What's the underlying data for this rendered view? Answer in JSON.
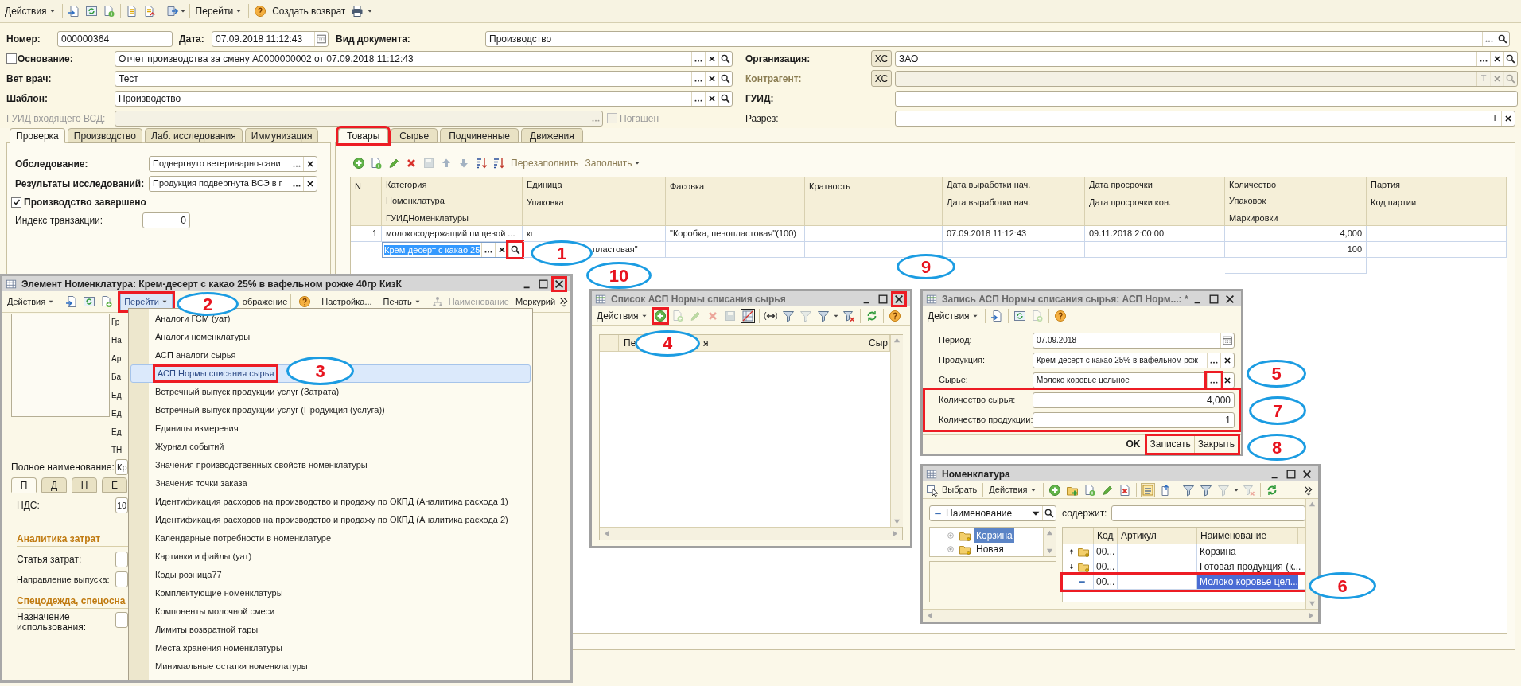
{
  "toolbar": {
    "actions": "Действия",
    "goto": "Перейти",
    "create_return": "Создать возврат"
  },
  "header": {
    "number": {
      "label": "Номер:",
      "value": "000000364"
    },
    "date": {
      "label": "Дата:",
      "value": "07.09.2018 11:12:43"
    },
    "doc_type": {
      "label": "Вид документа:",
      "value": "Производство"
    },
    "basis": {
      "label": "Основание:",
      "checked": false,
      "value": "Отчет производства за смену А0000000002 от 07.09.2018 11:12:43"
    },
    "vet": {
      "label": "Вет врач:",
      "value": "Тест"
    },
    "template": {
      "label": "Шаблон:",
      "value": "Производство"
    },
    "guid_vsd": {
      "label": "ГУИД входящего ВСД:",
      "disabled": true
    },
    "repaid": {
      "label": "Погашен",
      "checked": false,
      "disabled": true
    },
    "organization": {
      "label": "Организация:",
      "button": "ХС",
      "value": "ЗАО"
    },
    "counterparty": {
      "label": "Контрагент:",
      "button": "ХС",
      "disabled": true,
      "text_button": "T"
    },
    "guid": {
      "label": "ГУИД:"
    },
    "section": {
      "label": "Разрез:",
      "text_button": "T"
    }
  },
  "left_tabs": [
    {
      "label": "Проверка",
      "selected": true
    },
    {
      "label": "Производство",
      "selected": false
    },
    {
      "label": "Лаб. исследования",
      "selected": false
    },
    {
      "label": "Иммунизация",
      "selected": false
    }
  ],
  "inspection": {
    "survey": {
      "label": "Обследование:",
      "value": "Подвергнуто ветеринарно-сани"
    },
    "results": {
      "label": "Результаты исследований:",
      "value": "Продукция подвергнута ВСЭ в г"
    },
    "completed": {
      "label": "Производство завершено",
      "checked": true
    },
    "transaction_index": {
      "label": "Индекс транзакции:",
      "value": "0"
    }
  },
  "right_tabs": [
    {
      "label": "Товары",
      "selected": true,
      "highlighted": true
    },
    {
      "label": "Сырье",
      "selected": false,
      "highlighted": false
    },
    {
      "label": "Подчиненные",
      "selected": false,
      "highlighted": false
    },
    {
      "label": "Движения",
      "selected": false,
      "highlighted": false
    }
  ],
  "goods_toolbar": {
    "refill": "Перезаполнить",
    "fill": "Заполнить"
  },
  "goods_table": {
    "columns": [
      [
        "N"
      ],
      [
        "Категория",
        "Номенклатура",
        "ГУИДНоменклатуры"
      ],
      [
        "Единица",
        "Упаковка"
      ],
      [
        "Фасовка"
      ],
      [
        "Кратность"
      ],
      [
        "Дата выработки нач.",
        "Дата выработки нач."
      ],
      [
        "Дата просрочки",
        "Дата просрочки кон."
      ],
      [
        "Количество",
        "Упаковок",
        "Маркировки"
      ],
      [
        "Партия",
        "Код партии"
      ]
    ],
    "rows": [
      {
        "n": "1",
        "category": "молокосодержащий пищевой ...",
        "nomenclature_editor": {
          "value": "Крем-десерт с какао 25",
          "search_highlighted": true
        },
        "unit": "кг",
        "packaging": "пластовая\"",
        "packing": "\"Коробка, пенопластовая\"(100)",
        "production_date": "07.09.2018 11:12:43",
        "expiry_date": "09.11.2018 2:00:00",
        "quantity": "4,000",
        "packages": "100"
      }
    ]
  },
  "element_window": {
    "title": "Элемент Номенклатура: Крем-десерт с какао 25% в вафельном рожке 40гр КизК",
    "close_highlighted": true,
    "toolbar": {
      "actions": "Действия",
      "goto": "Перейти",
      "goto_highlighted": true,
      "image": "ображение",
      "settings": "Настройка...",
      "print": "Печать",
      "name": "Наименование",
      "mercury": "Меркурий"
    },
    "side_labels": [
      "Гр",
      "На",
      "Ар",
      "Ба",
      "Ед",
      "Ед",
      "Ед",
      "ТН"
    ],
    "full_name": {
      "label": "Полное наименование:",
      "value": "Кр"
    },
    "tabs": [
      {
        "label": "П",
        "selected": true
      },
      {
        "label": "Д",
        "selected": false
      },
      {
        "label": "Н",
        "selected": false
      },
      {
        "label": "Е",
        "selected": false
      }
    ],
    "vat": {
      "label": "НДС:",
      "value": "10"
    },
    "cost_section": "Аналитика затрат",
    "cost_item": "Статья затрат:",
    "output_direction": "Направление выпуска:",
    "workwear_section": "Спецодежда, спецосна",
    "purpose": "Назначение использования:"
  },
  "goto_menu": [
    {
      "label": "Аналоги ГСМ (уат)",
      "selected": false,
      "highlighted": false
    },
    {
      "label": "Аналоги номенклатуры",
      "selected": false,
      "highlighted": false
    },
    {
      "label": "АСП аналоги сырья",
      "selected": false,
      "highlighted": false
    },
    {
      "label": "АСП Нормы списания сырья",
      "selected": true,
      "highlighted": true
    },
    {
      "label": "Встречный выпуск продукции услуг (Затрата)",
      "selected": false,
      "highlighted": false
    },
    {
      "label": "Встречный выпуск продукции услуг (Продукция (услуга))",
      "selected": false,
      "highlighted": false
    },
    {
      "label": "Единицы измерения",
      "selected": false,
      "highlighted": false
    },
    {
      "label": "Журнал событий",
      "selected": false,
      "highlighted": false
    },
    {
      "label": "Значения производственных свойств номенклатуры",
      "selected": false,
      "highlighted": false
    },
    {
      "label": "Значения точки заказа",
      "selected": false,
      "highlighted": false
    },
    {
      "label": "Идентификация расходов на производство и продажу по ОКПД (Аналитика расхода 1)",
      "selected": false,
      "highlighted": false
    },
    {
      "label": "Идентификация расходов на производство и продажу по ОКПД (Аналитика расхода 2)",
      "selected": false,
      "highlighted": false
    },
    {
      "label": "Календарные потребности в номенклатуре",
      "selected": false,
      "highlighted": false
    },
    {
      "label": "Картинки и файлы (уат)",
      "selected": false,
      "highlighted": false
    },
    {
      "label": "Коды розница77",
      "selected": false,
      "highlighted": false
    },
    {
      "label": "Комплектующие номенклатуры",
      "selected": false,
      "highlighted": false
    },
    {
      "label": "Компоненты молочной смеси",
      "selected": false,
      "highlighted": false
    },
    {
      "label": "Лимиты возвратной тары",
      "selected": false,
      "highlighted": false
    },
    {
      "label": "Места хранения номенклатуры",
      "selected": false,
      "highlighted": false
    },
    {
      "label": "Минимальные остатки номенклатуры",
      "selected": false,
      "highlighted": false
    }
  ],
  "list_window": {
    "title": "Список АСП Нормы списания сырья",
    "actions": "Действия",
    "add_highlighted": true,
    "close_highlighted": true,
    "columns": [
      "Пе",
      "я",
      "Сыр"
    ]
  },
  "record_window": {
    "title": "Запись АСП Нормы списания сырья: АСП Норм...: *",
    "actions": "Действия",
    "fields": [
      {
        "kind": "date",
        "label": "Период:",
        "value": "07.09.2018",
        "button_highlighted": false
      },
      {
        "kind": "ref",
        "label": "Продукция:",
        "value": "Крем-десерт с какао 25% в вафельном рож",
        "button_highlighted": false
      },
      {
        "kind": "ref",
        "label": "Сырье:",
        "value": "Молоко коровье цельное",
        "button_highlighted": true
      }
    ],
    "quantities": {
      "highlighted": true,
      "items": [
        {
          "label": "Количество сырья:",
          "value": "4,000"
        },
        {
          "label": "Количество продукции:",
          "value": "1"
        }
      ]
    },
    "ok": "OK",
    "write": "Записать",
    "close": "Закрыть",
    "buttons_highlighted": true
  },
  "catalog_window": {
    "title": "Номенклатура",
    "select": "Выбрать",
    "actions": "Действия",
    "filter_field": "Наименование",
    "contains": "содержит:",
    "tree": [
      {
        "label": "Корзина",
        "selected": true
      },
      {
        "label": "Новая",
        "selected": false
      }
    ],
    "columns": [
      "Код",
      "Артикул",
      "Наименование"
    ],
    "rows": [
      {
        "kind": "group_up",
        "code": "00...",
        "name": "Корзина",
        "selected": false,
        "highlighted": false
      },
      {
        "kind": "group_down",
        "code": "00...",
        "name": "Готовая продукция (к...",
        "selected": false,
        "highlighted": false
      },
      {
        "kind": "item",
        "code": "00...",
        "name": "Молоко коровье цел...",
        "selected": true,
        "highlighted": true
      }
    ]
  },
  "annotations": [
    {
      "number": "1"
    },
    {
      "number": "2"
    },
    {
      "number": "3"
    },
    {
      "number": "4"
    },
    {
      "number": "5"
    },
    {
      "number": "6"
    },
    {
      "number": "7"
    },
    {
      "number": "8"
    },
    {
      "number": "9"
    },
    {
      "number": "10"
    }
  ]
}
